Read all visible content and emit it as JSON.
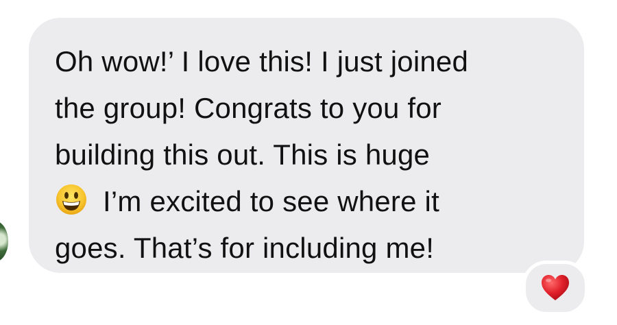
{
  "message": {
    "lines": [
      "Oh wow!’ I love this! I just joined",
      "the group! Congrats to you for",
      "building this out. This is huge",
      "I’m excited to see where it",
      "goes. That’s for including me!"
    ],
    "emoji_icon": "smiling-face-emoji"
  },
  "reaction": {
    "icon": "red-heart-icon",
    "color": "#e0202a"
  },
  "colors": {
    "bubble": "#ececee",
    "text": "#111111"
  }
}
